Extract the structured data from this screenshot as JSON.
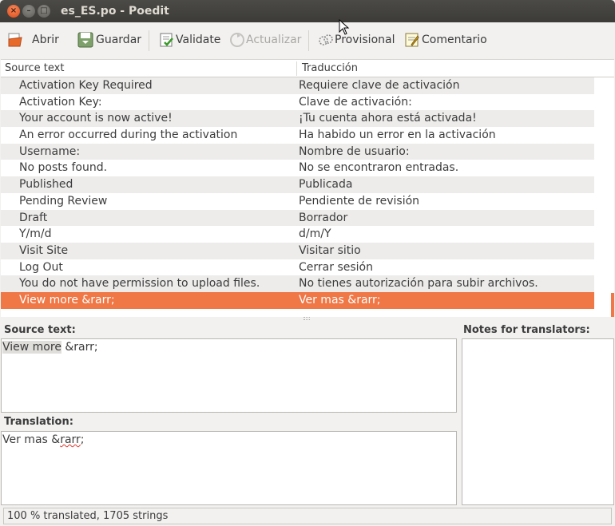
{
  "window": {
    "title": "es_ES.po - Poedit"
  },
  "toolbar": {
    "open": "Abrir",
    "save": "Guardar",
    "validate": "Validate",
    "update": "Actualizar",
    "fuzzy": "Provisional",
    "comment": "Comentario"
  },
  "list": {
    "col_source": "Source text",
    "col_translation": "Traducción",
    "rows": [
      {
        "source": "Activation Key Required",
        "translation": "Requiere clave de activación"
      },
      {
        "source": "Activation Key:",
        "translation": "Clave de activación:"
      },
      {
        "source": "Your account is now active!",
        "translation": "¡Tu cuenta ahora está activada!"
      },
      {
        "source": "An error occurred during the activation",
        "translation": "Ha habido un error en la activación"
      },
      {
        "source": "Username:",
        "translation": "Nombre de usuario:"
      },
      {
        "source": "No posts found.",
        "translation": "No se encontraron entradas."
      },
      {
        "source": "Published",
        "translation": "Publicada"
      },
      {
        "source": "Pending Review",
        "translation": "Pendiente de revisión"
      },
      {
        "source": "Draft",
        "translation": "Borrador"
      },
      {
        "source": "Y/m/d",
        "translation": "d/m/Y"
      },
      {
        "source": "Visit Site",
        "translation": "Visitar sitio"
      },
      {
        "source": "Log Out",
        "translation": "Cerrar sesión"
      },
      {
        "source": "You do not have permission to upload files.",
        "translation": "No tienes autorización para subir archivos."
      },
      {
        "source": "View more &rarr;",
        "translation": "Ver mas &rarr;"
      }
    ]
  },
  "editor": {
    "source_label": "Source text:",
    "source_text_a": "View more",
    "source_text_b": " &rarr;",
    "translation_label": "Translation:",
    "translation_text_a": "Ver mas &",
    "translation_text_b": "rarr",
    "translation_text_c": ";",
    "notes_label": "Notes for translators:"
  },
  "status": {
    "text": "100 % translated, 1705 strings"
  },
  "colors": {
    "selection": "#f07746",
    "titlebar": "#3c3b37"
  }
}
